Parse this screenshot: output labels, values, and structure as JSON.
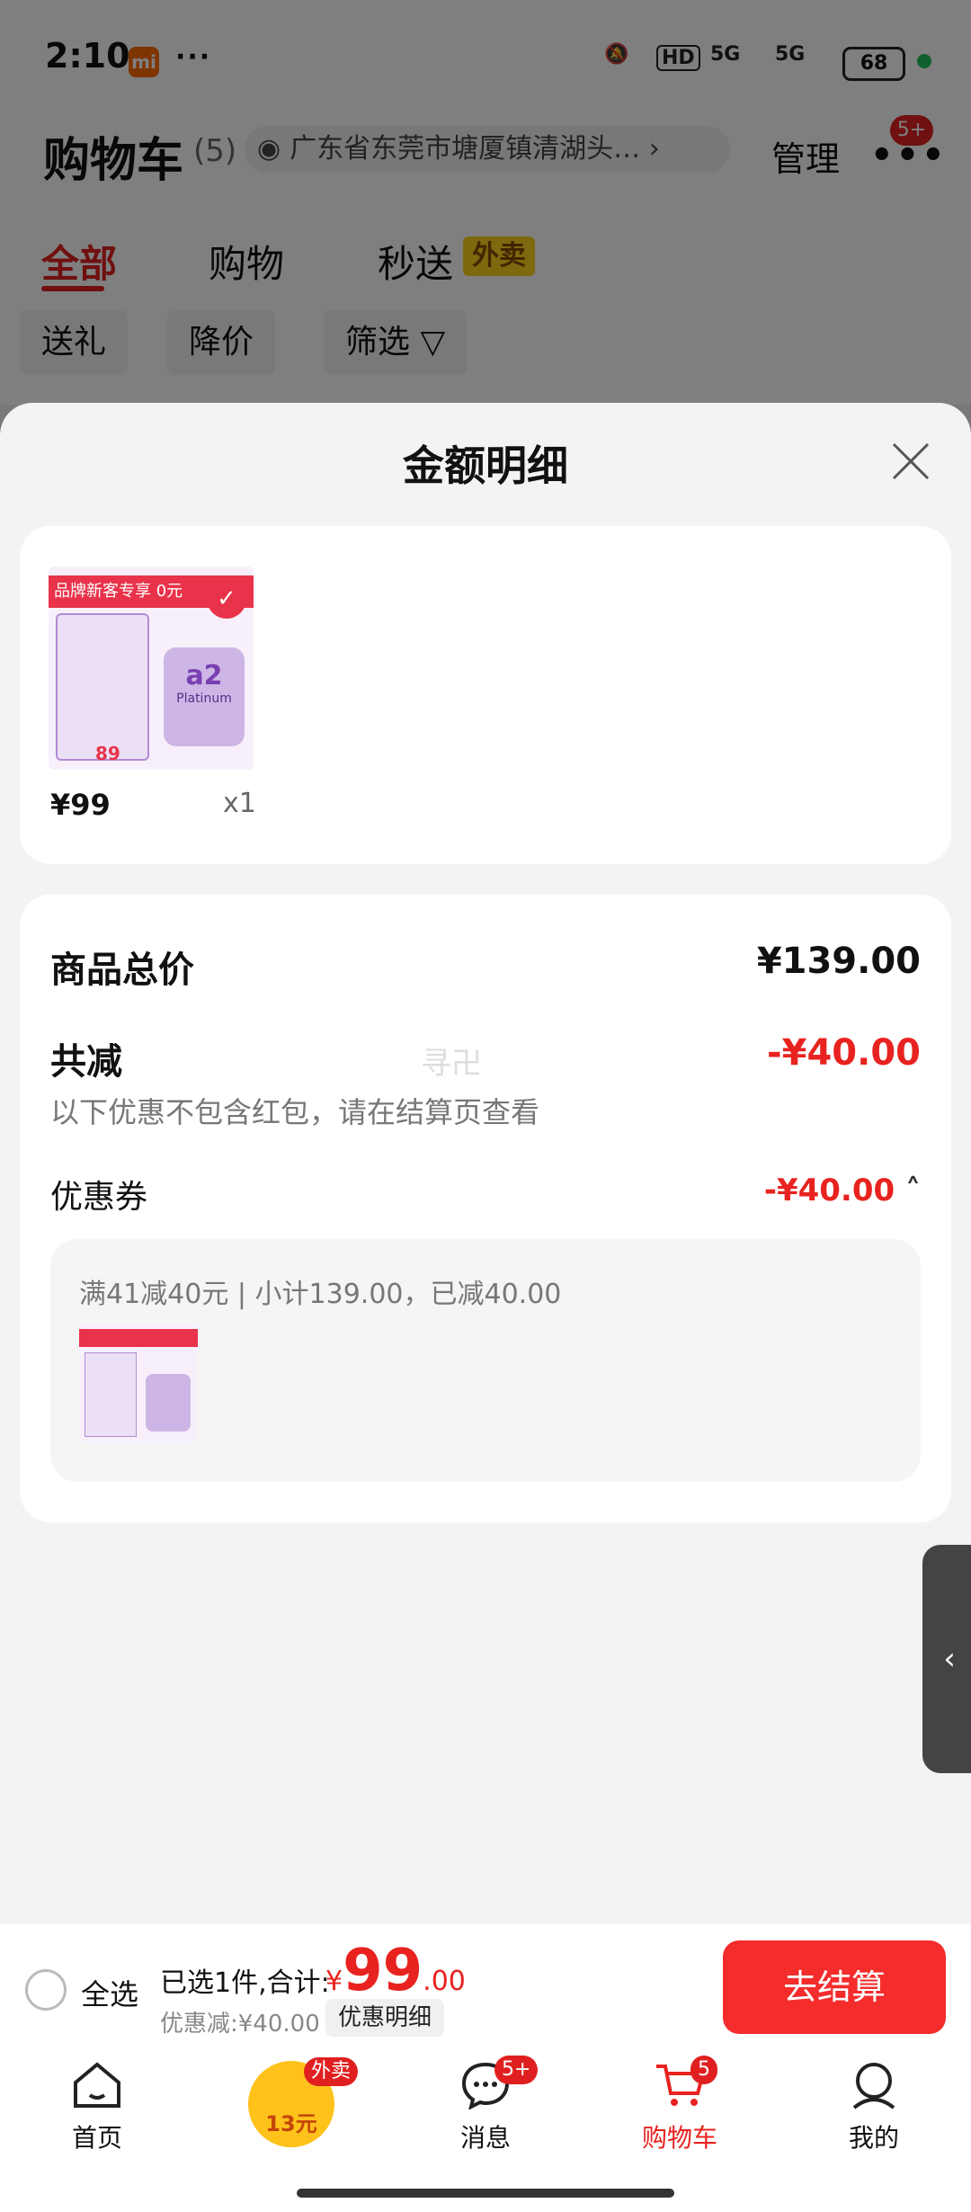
{
  "status_bar": {
    "time": "2:10",
    "battery": "68",
    "network": "5G",
    "hd": "HD"
  },
  "header": {
    "title": "购物车",
    "count": "(5)",
    "address": "广东省东莞市塘厦镇清湖头…",
    "manage": "管理",
    "more_badge": "5+"
  },
  "tabs": [
    {
      "label": "全部"
    },
    {
      "label": "购物"
    },
    {
      "label": "秒送"
    }
  ],
  "takeout_tag": "外卖",
  "filters": [
    {
      "label": "送礼"
    },
    {
      "label": "降价"
    },
    {
      "label": "筛选"
    }
  ],
  "sheet": {
    "title": "金额明细",
    "product": {
      "price": "¥99",
      "qty": "x1",
      "image_text": {
        "banner": "品牌新客专享 0元",
        "brand": "a2",
        "sub": "Platinum",
        "price": "89"
      }
    },
    "total_label": "商品总价",
    "total_value": "¥139.00",
    "reduce_label": "共减",
    "reduce_value": "-¥40.00",
    "note": "以下优惠不包含红包，请在结算页查看",
    "watermark": "寻卍",
    "coupon_label": "优惠券",
    "coupon_value": "-¥40.00",
    "coupon_detail": "满41减40元 | 小计139.00，已减40.00"
  },
  "bottom": {
    "select_all": "全选",
    "selected_info": "已选1件,合计:",
    "currency": "¥",
    "total_int": "99",
    "total_dec": ".00",
    "discount": "优惠减:¥40.00",
    "detail_button": "优惠明细",
    "checkout": "去结算"
  },
  "tabbar": [
    {
      "label": "首页"
    },
    {
      "label": "13元",
      "badge": "外卖"
    },
    {
      "label": "消息",
      "badge": "5+"
    },
    {
      "label": "购物车",
      "badge": "5"
    },
    {
      "label": "我的"
    }
  ],
  "colors": {
    "accent": "#e8231f",
    "checkout": "#f42c2c",
    "takeout": "#ffd21f"
  }
}
